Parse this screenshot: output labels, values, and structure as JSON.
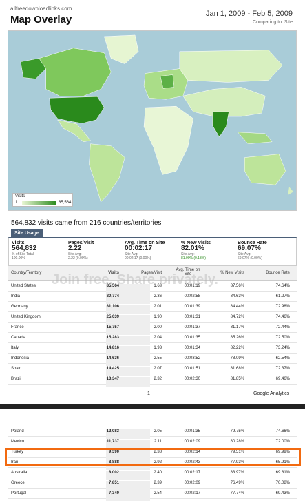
{
  "header": {
    "site": "allfreedownloadlinks.com",
    "title": "Map Overlay",
    "date_range": "Jan 1, 2009 - Feb 5, 2009",
    "comparing": "Comparing to: Site"
  },
  "legend": {
    "title": "Visits",
    "min": "1",
    "max": "85,564"
  },
  "summary": "564,832 visits came from 216 countries/territories",
  "tab_label": "Site Usage",
  "metrics": [
    {
      "label": "Visits",
      "value": "564,832",
      "sub": "% of Site Total:",
      "cmp": "100.00%"
    },
    {
      "label": "Pages/Visit",
      "value": "2.22",
      "sub": "Site Avg:",
      "cmp": "2.22 (0.00%)"
    },
    {
      "label": "Avg. Time on Site",
      "value": "00:02:17",
      "sub": "Site Avg:",
      "cmp": "00:02:17 (0.00%)"
    },
    {
      "label": "% New Visits",
      "value": "82.01%",
      "sub": "Site Avg:",
      "cmp": "81.90% (0.13%)"
    },
    {
      "label": "Bounce Rate",
      "value": "69.07%",
      "sub": "Site Avg:",
      "cmp": "69.07% (0.00%)"
    }
  ],
  "columns": [
    "Country/Territory",
    "Visits",
    "Pages/Visit",
    "Avg. Time on Site",
    "% New Visits",
    "Bounce Rate"
  ],
  "rows": [
    [
      "United States",
      "85,564",
      "1.63",
      "00:01:19",
      "87.56%",
      "74.64%"
    ],
    [
      "India",
      "80,774",
      "2.36",
      "00:02:58",
      "84.63%",
      "61.27%"
    ],
    [
      "Germany",
      "31,106",
      "2.01",
      "00:01:39",
      "84.44%",
      "72.98%"
    ],
    [
      "United Kingdom",
      "25,039",
      "1.90",
      "00:01:31",
      "84.72%",
      "74.46%"
    ],
    [
      "France",
      "15,757",
      "2.00",
      "00:01:37",
      "81.17%",
      "72.44%"
    ],
    [
      "Canada",
      "15,283",
      "2.04",
      "00:01:35",
      "85.26%",
      "72.50%"
    ],
    [
      "Italy",
      "14,816",
      "1.93",
      "00:01:34",
      "82.22%",
      "73.24%"
    ],
    [
      "Indonesia",
      "14,636",
      "2.55",
      "00:03:52",
      "78.09%",
      "62.54%"
    ],
    [
      "Spain",
      "14,425",
      "2.07",
      "00:01:51",
      "81.68%",
      "72.37%"
    ],
    [
      "Brazil",
      "13,347",
      "2.32",
      "00:02:30",
      "81.85%",
      "69.46%"
    ]
  ],
  "page_number": "1",
  "footer_brand": "Google Analytics",
  "rows2": [
    [
      "Poland",
      "12,083",
      "2.05",
      "00:01:35",
      "79.75%",
      "74.66%"
    ],
    [
      "Mexico",
      "11,737",
      "2.11",
      "00:02:09",
      "80.28%",
      "72.00%"
    ],
    [
      "Turkey",
      "9,390",
      "2.38",
      "00:02:14",
      "79.51%",
      "69.99%"
    ],
    [
      "Iran",
      "8,888",
      "2.92",
      "00:02:43",
      "77.93%",
      "65.91%"
    ],
    [
      "Australia",
      "8,002",
      "2.40",
      "00:02:17",
      "83.97%",
      "69.81%"
    ],
    [
      "Greece",
      "7,851",
      "2.39",
      "00:02:09",
      "76.49%",
      "70.08%"
    ],
    [
      "Portugal",
      "7,340",
      "2.54",
      "00:02:17",
      "77.74%",
      "69.43%"
    ]
  ],
  "watermark": {
    "logo": "photobucket",
    "text": "Join free. Share privately."
  },
  "colors": {
    "accent": "#4b5f78",
    "highlight": "#f26a10",
    "map_dark": "#2a8a1c",
    "map_light": "#eaf7d5",
    "ocean": "#a9ccd8"
  }
}
